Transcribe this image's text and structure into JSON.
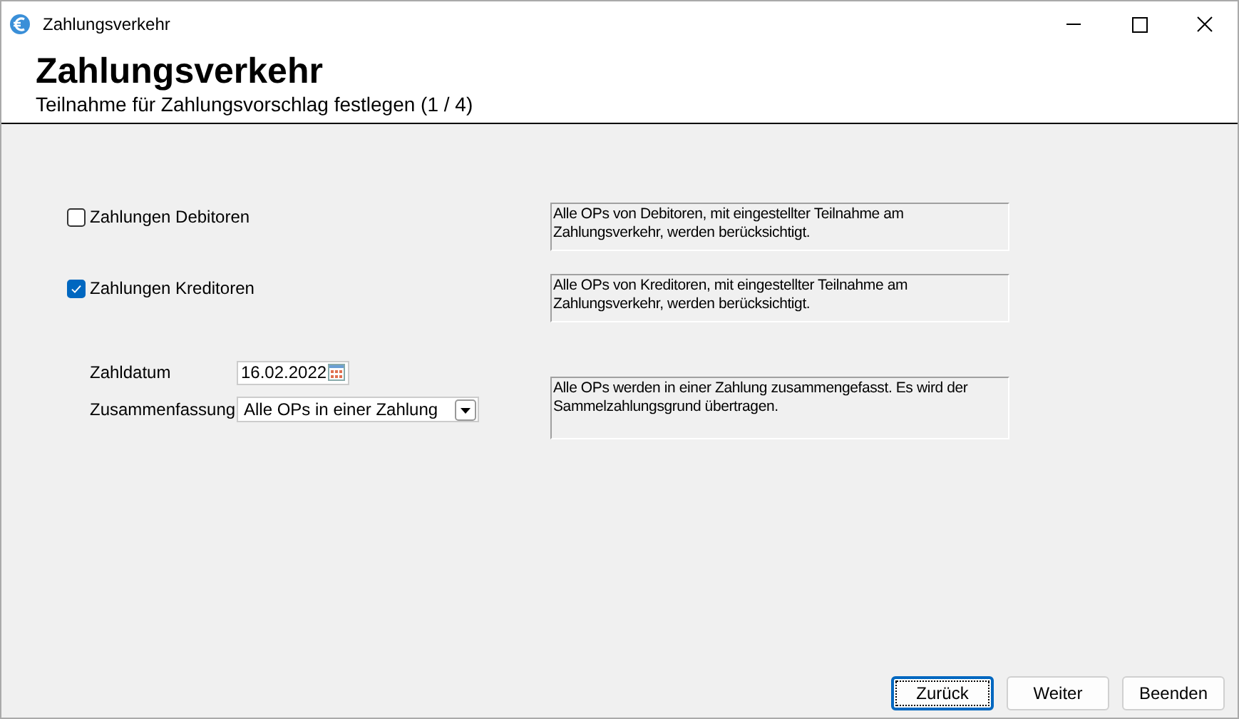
{
  "window": {
    "title": "Zahlungsverkehr"
  },
  "header": {
    "title": "Zahlungsverkehr",
    "subtitle": "Teilnahme für Zahlungsvorschlag festlegen (1 / 4)"
  },
  "options": [
    {
      "label": "Zahlungen Debitoren",
      "checked": false,
      "info": "Alle OPs von Debitoren, mit eingestellter Teilnahme am Zahlungsverkehr, werden berücksichtigt."
    },
    {
      "label": "Zahlungen Kreditoren",
      "checked": true,
      "info": "Alle OPs von Kreditoren, mit eingestellter Teilnahme am Zahlungsverkehr, werden berücksichtigt."
    }
  ],
  "zahldatum": {
    "label": "Zahldatum",
    "value": "16.02.2022"
  },
  "zusammenfassung": {
    "label": "Zusammenfassung",
    "value": "Alle OPs in einer Zahlung",
    "info": "Alle OPs werden in einer Zahlung zusammengefasst. Es wird der Sammelzahlungsgrund übertragen."
  },
  "buttons": [
    {
      "label": "Zurück",
      "focused": true
    },
    {
      "label": "Weiter",
      "focused": false
    },
    {
      "label": "Beenden",
      "focused": false
    }
  ]
}
